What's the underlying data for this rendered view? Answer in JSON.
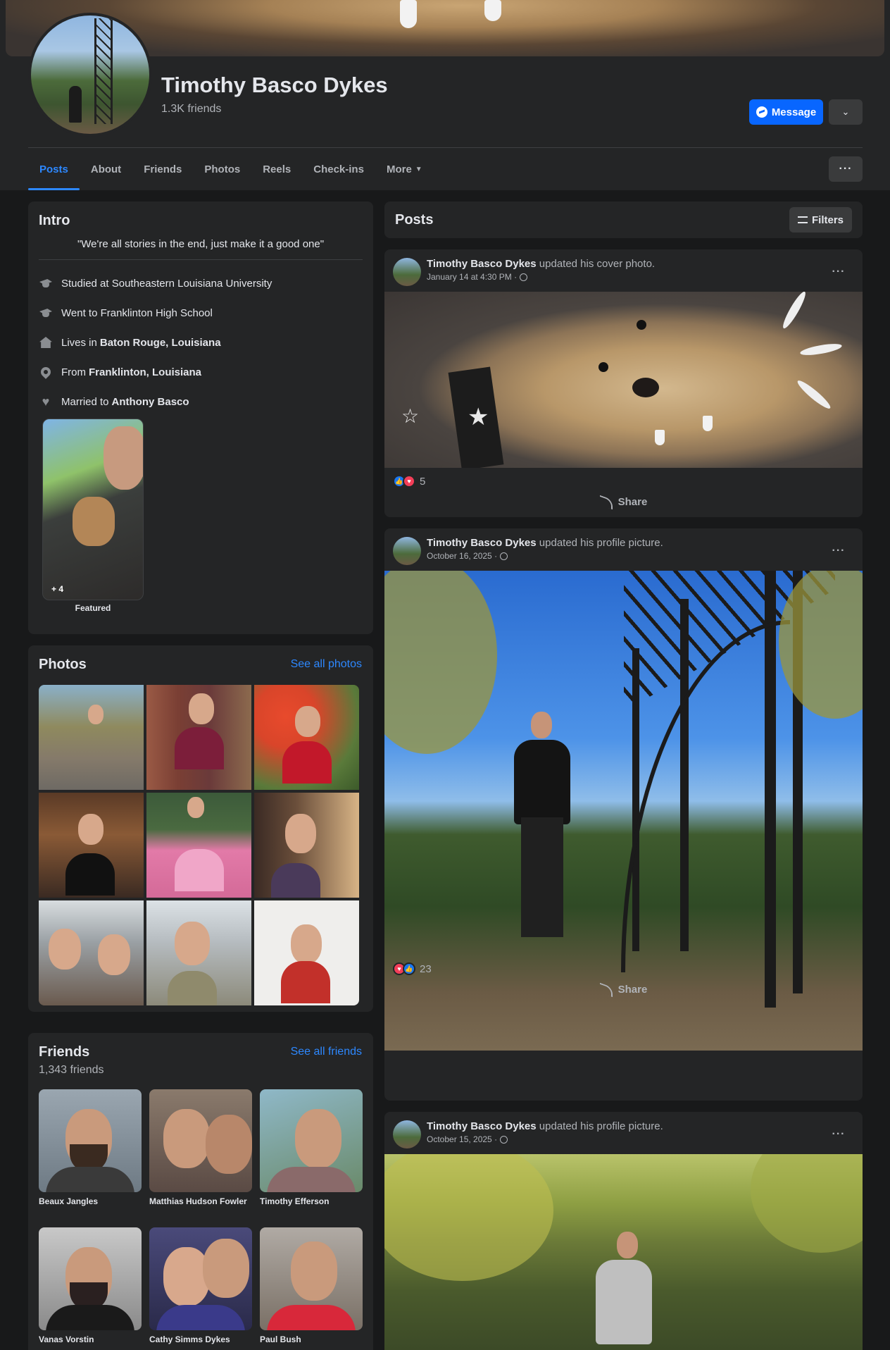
{
  "profile": {
    "name": "Timothy Basco Dykes",
    "friend_count": "1.3K friends",
    "message_label": "Message"
  },
  "tabs": [
    {
      "label": "Posts"
    },
    {
      "label": "About"
    },
    {
      "label": "Friends"
    },
    {
      "label": "Photos"
    },
    {
      "label": "Reels"
    },
    {
      "label": "Check-ins"
    },
    {
      "label": "More"
    }
  ],
  "intro": {
    "title": "Intro",
    "bio": "\"We're all stories in the end, just make it a good one\"",
    "items": [
      {
        "icon": "graduation-cap-icon",
        "prefix": "Studied at Southeastern Louisiana University",
        "bold": ""
      },
      {
        "icon": "graduation-cap-icon",
        "prefix": "Went to Franklinton High School",
        "bold": ""
      },
      {
        "icon": "home-icon",
        "prefix": "Lives in",
        "bold": "Baton Rouge, Louisiana"
      },
      {
        "icon": "location-pin-icon",
        "prefix": "From",
        "bold": "Franklinton, Louisiana"
      },
      {
        "icon": "heart-icon",
        "prefix": "Married to",
        "bold": "Anthony Basco"
      }
    ],
    "featured_count": "+ 4",
    "featured_label": "Featured"
  },
  "photos": {
    "title": "Photos",
    "see_all": "See all photos"
  },
  "friends": {
    "title": "Friends",
    "see_all": "See all friends",
    "count": "1,343 friends",
    "list": [
      {
        "name": "Beaux Jangles"
      },
      {
        "name": "Matthias Hudson Fowler"
      },
      {
        "name": "Timothy Efferson"
      },
      {
        "name": "Vanas Vorstin"
      },
      {
        "name": "Cathy Simms Dykes"
      },
      {
        "name": "Paul Bush"
      }
    ]
  },
  "posts_header": {
    "title": "Posts",
    "filters_label": "Filters"
  },
  "posts": [
    {
      "author": "Timothy Basco Dykes",
      "action": " updated his cover photo.",
      "date": "January 14 at 4:30 PM ·",
      "reaction_count": "5",
      "share_label": "Share"
    },
    {
      "author": "Timothy Basco Dykes",
      "action": " updated his profile picture.",
      "date": "October 16, 2025 ·",
      "reaction_count": "23",
      "share_label": "Share"
    },
    {
      "author": "Timothy Basco Dykes",
      "action": " updated his profile picture.",
      "date": "October 15, 2025 ·"
    }
  ],
  "colors": {
    "accent": "#2d88ff",
    "button_blue": "#0866ff",
    "background": "#18191a",
    "card": "#242526"
  }
}
